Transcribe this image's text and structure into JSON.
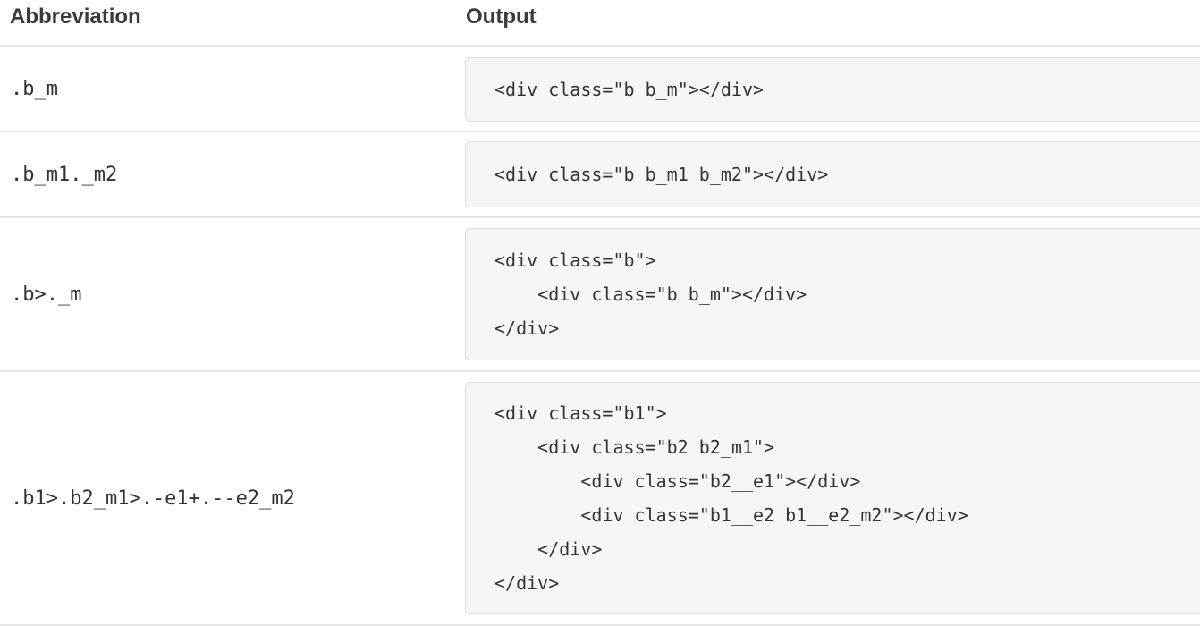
{
  "header": {
    "abbreviation_label": "Abbreviation",
    "output_label": "Output"
  },
  "rows": [
    {
      "abbreviation": ".b_m",
      "output_lines": [
        "<div class=\"b b_m\"></div>"
      ]
    },
    {
      "abbreviation": ".b_m1._m2",
      "output_lines": [
        "<div class=\"b b_m1 b_m2\"></div>"
      ]
    },
    {
      "abbreviation": ".b>._m",
      "output_lines": [
        "<div class=\"b\">",
        "    <div class=\"b b_m\"></div>",
        "</div>"
      ]
    },
    {
      "abbreviation": ".b1>.b2_m1>.-e1+.--e2_m2",
      "output_lines": [
        "<div class=\"b1\">",
        "    <div class=\"b2 b2_m1\">",
        "        <div class=\"b2__e1\"></div>",
        "        <div class=\"b1__e2 b1__e2_m2\"></div>",
        "    </div>",
        "</div>"
      ]
    }
  ]
}
